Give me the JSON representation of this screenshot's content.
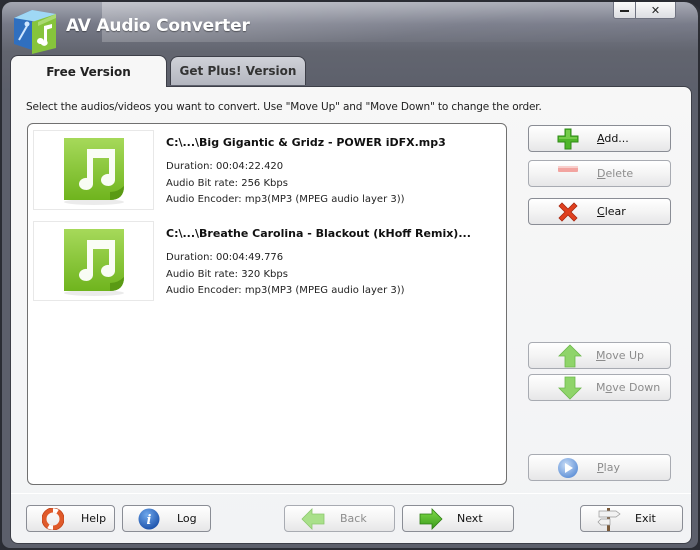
{
  "window": {
    "title": "AV Audio Converter",
    "minimize_glyph": "—",
    "close_glyph": "✕"
  },
  "tabs": [
    {
      "label": "Free Version",
      "active": true
    },
    {
      "label": "Get Plus! Version",
      "active": false
    }
  ],
  "instruction": "Select the audios/videos you want to convert. Use \"Move Up\" and \"Move Down\" to change the order.",
  "files": [
    {
      "name": "C:\\...\\Big Gigantic & Gridz - POWER iDFX.mp3",
      "duration": "Duration: 00:04:22.420",
      "bitrate": "Audio Bit rate: 256 Kbps",
      "encoder": "Audio Encoder: mp3(MP3 (MPEG audio layer 3))",
      "icon": "music-note-icon"
    },
    {
      "name": "C:\\...\\Breathe Carolina - Blackout (kHoff Remix)...",
      "duration": "Duration: 00:04:49.776",
      "bitrate": "Audio Bit rate: 320 Kbps",
      "encoder": "Audio Encoder: mp3(MP3 (MPEG audio layer 3))",
      "icon": "music-note-icon"
    }
  ],
  "side_buttons": {
    "add": {
      "mnemonic": "A",
      "rest": "dd...",
      "icon": "plus-icon",
      "enabled": true
    },
    "delete": {
      "mnemonic": "D",
      "rest": "elete",
      "icon": "minus-icon",
      "enabled": false
    },
    "clear": {
      "mnemonic": "C",
      "rest": "lear",
      "icon": "red-x-icon",
      "enabled": true
    },
    "move_up": {
      "mnemonic": "M",
      "rest": "ove Up",
      "icon": "arrow-up-icon",
      "enabled": false
    },
    "move_down": {
      "pre": "M",
      "mnemonic": "o",
      "rest": "ve Down",
      "icon": "arrow-down-icon",
      "enabled": false
    },
    "play": {
      "mnemonic": "P",
      "rest": "lay",
      "icon": "play-icon",
      "enabled": false
    }
  },
  "bottom_buttons": {
    "help": {
      "label": "Help",
      "icon": "lifebuoy-icon"
    },
    "log": {
      "label": "Log",
      "icon": "info-icon"
    },
    "back": {
      "label": "Back",
      "icon": "arrow-left-icon",
      "enabled": false
    },
    "next": {
      "label": "Next",
      "icon": "arrow-right-icon",
      "enabled": true
    },
    "exit": {
      "label": "Exit",
      "icon": "signpost-icon"
    }
  },
  "colors": {
    "accent_green": "#7cc42a",
    "title_bar": "#5c5f6b",
    "panel_bg": "#f4f4f4"
  }
}
